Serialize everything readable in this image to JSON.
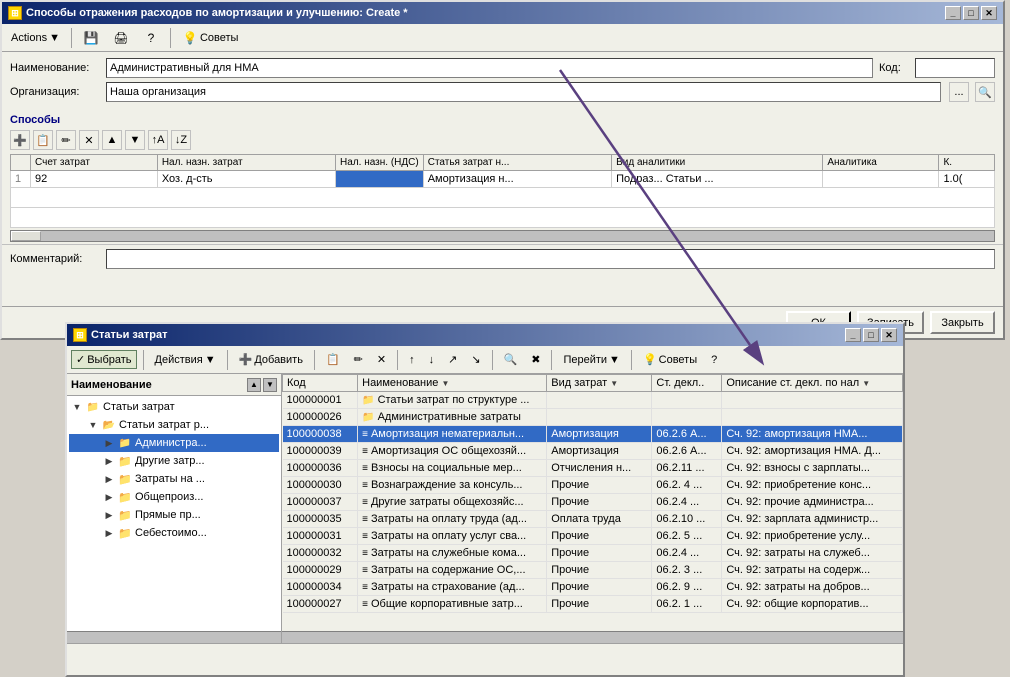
{
  "mainWindow": {
    "title": "Способы отражения расходов по амортизации и улучшению: Create *",
    "toolbar": {
      "actionsLabel": "Actions",
      "advisorLabel": "Советы"
    },
    "form": {
      "nameLabel": "Наименование:",
      "nameValue": "Административный для НМА",
      "codeLabel": "Код:",
      "codeValue": "",
      "orgLabel": "Организация:",
      "orgValue": "Наша организация",
      "sectionLabel": "Способы"
    },
    "table": {
      "columns": [
        "Счет затрат",
        "Нал. назн. затрат",
        "Нал. назн. (НДС)",
        "Статья затрат н...",
        "Вид аналитики",
        "Аналитика",
        "К."
      ],
      "rows": [
        {
          "num": "1",
          "col1": "92",
          "col2": "Хоз. д-сть",
          "col3": "",
          "col4": "Амортизация н...",
          "col5": "Подраз...  Статьи ...",
          "col6": "",
          "col7": "1.0("
        }
      ]
    },
    "commentLabel": "Комментарий:",
    "buttons": {
      "ok": "ОК",
      "save": "Записать",
      "close": "Закрыть"
    }
  },
  "subWindow": {
    "title": "Статьи затрат",
    "toolbar": {
      "selectLabel": "Выбрать",
      "actionsLabel": "Действия",
      "addLabel": "Добавить",
      "advisorLabel": "Советы",
      "gotoLabel": "Перейти"
    },
    "tree": {
      "headerLabel": "Наименование",
      "items": [
        {
          "level": 1,
          "type": "root",
          "label": "Статьи затрат",
          "expanded": true,
          "selected": false
        },
        {
          "level": 2,
          "type": "folder",
          "label": "Статьи затрат р...",
          "expanded": true,
          "selected": false
        },
        {
          "level": 3,
          "type": "folder",
          "label": "Администра...",
          "expanded": false,
          "selected": true
        },
        {
          "level": 3,
          "type": "folder",
          "label": "Другие затр...",
          "expanded": false,
          "selected": false
        },
        {
          "level": 3,
          "type": "folder",
          "label": "Затраты на ...",
          "expanded": false,
          "selected": false
        },
        {
          "level": 3,
          "type": "folder",
          "label": "Общепроиз...",
          "expanded": false,
          "selected": false
        },
        {
          "level": 3,
          "type": "folder",
          "label": "Прямые пр...",
          "expanded": false,
          "selected": false
        },
        {
          "level": 3,
          "type": "folder",
          "label": "Себестоимо...",
          "expanded": false,
          "selected": false
        }
      ]
    },
    "list": {
      "columns": [
        "Код",
        "Наименование",
        "Вид затрат",
        "Ст. декл...",
        "Описание ст. декл. по нал"
      ],
      "rows": [
        {
          "code": "100000001",
          "name": "Статьи затрат по структуре ...",
          "type": "",
          "decl": "",
          "desc": "",
          "selected": false,
          "isFolder": true
        },
        {
          "code": "100000026",
          "name": "Административные затраты",
          "type": "",
          "decl": "",
          "desc": "",
          "selected": false,
          "isFolder": true
        },
        {
          "code": "100000038",
          "name": "Амортизация нематериальн...",
          "type": "Амортизация",
          "decl": "06.2.6 А...",
          "desc": "Сч. 92: амортизация НМА...",
          "selected": true,
          "isFolder": false
        },
        {
          "code": "100000039",
          "name": "Амортизация ОС общехозяй...",
          "type": "Амортизация",
          "decl": "06.2.6 А...",
          "desc": "Сч. 92: амортизация НМА. Д...",
          "selected": false,
          "isFolder": false
        },
        {
          "code": "100000036",
          "name": "Взносы на социальные мер...",
          "type": "Отчисления н...",
          "decl": "06.2.11 ...",
          "desc": "Сч. 92: взносы с зарплаты...",
          "selected": false,
          "isFolder": false
        },
        {
          "code": "100000030",
          "name": "Вознаграждение за консуль...",
          "type": "Прочие",
          "decl": "06.2. 4 ...",
          "desc": "Сч. 92: приобретение конс...",
          "selected": false,
          "isFolder": false
        },
        {
          "code": "100000037",
          "name": "Другие затраты общехозяйс...",
          "type": "Прочие",
          "decl": "06.2.4 ...",
          "desc": "Сч. 92: прочие администра...",
          "selected": false,
          "isFolder": false
        },
        {
          "code": "100000035",
          "name": "Затраты на оплату труда (ад...",
          "type": "Оплата труда",
          "decl": "06.2.10 ...",
          "desc": "Сч. 92: зарплата администр...",
          "selected": false,
          "isFolder": false
        },
        {
          "code": "100000031",
          "name": "Затраты на оплату услуг сва...",
          "type": "Прочие",
          "decl": "06.2. 5 ...",
          "desc": "Сч. 92: приобретение услу...",
          "selected": false,
          "isFolder": false
        },
        {
          "code": "100000032",
          "name": "Затраты на служебные кома...",
          "type": "Прочие",
          "decl": "06.2.4 ...",
          "desc": "Сч. 92: затраты на служеб...",
          "selected": false,
          "isFolder": false
        },
        {
          "code": "100000029",
          "name": "Затраты на содержание ОС,...",
          "type": "Прочие",
          "decl": "06.2. 3 ...",
          "desc": "Сч. 92: затраты на содерж...",
          "selected": false,
          "isFolder": false
        },
        {
          "code": "100000034",
          "name": "Затраты на страхование (ад...",
          "type": "Прочие",
          "decl": "06.2. 9 ...",
          "desc": "Сч. 92: затраты на добров...",
          "selected": false,
          "isFolder": false
        },
        {
          "code": "100000027",
          "name": "Общие корпоративные затр...",
          "type": "Прочие",
          "decl": "06.2. 1 ...",
          "desc": "Сч. 92: общие корпоратив...",
          "selected": false,
          "isFolder": false
        }
      ]
    }
  }
}
